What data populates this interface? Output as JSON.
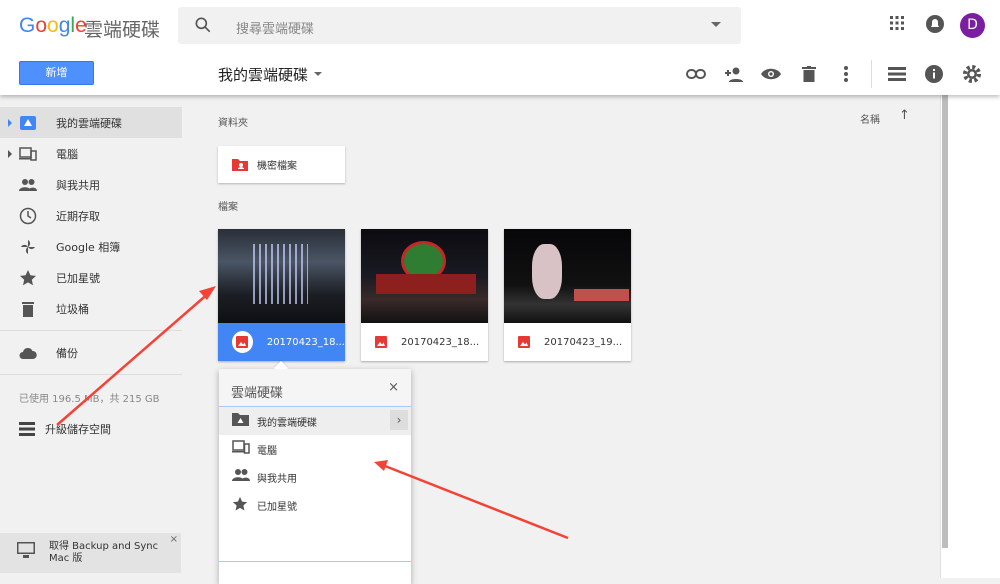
{
  "header": {
    "logo": "Google",
    "product": "雲端硬碟",
    "search_placeholder": "搜尋雲端硬碟",
    "avatar_letter": "D"
  },
  "toolbar": {
    "new_label": "新增",
    "breadcrumb": "我的雲端硬碟"
  },
  "sidebar": {
    "items": [
      {
        "label": "我的雲端硬碟"
      },
      {
        "label": "電腦"
      },
      {
        "label": "與我共用"
      },
      {
        "label": "近期存取"
      },
      {
        "label": "Google 相簿"
      },
      {
        "label": "已加星號"
      },
      {
        "label": "垃圾桶"
      },
      {
        "label": "備份"
      }
    ],
    "usage": "已使用 196.5 MB，共 215 GB",
    "upgrade": "升級儲存空間",
    "promo": "取得 Backup and Sync Mac 版",
    "promo_close": "×"
  },
  "main": {
    "folders_heading": "資料夾",
    "sort_label": "名稱",
    "folders": [
      {
        "name": "機密檔案"
      }
    ],
    "files_heading": "檔案",
    "files": [
      {
        "name": "20170423_18..."
      },
      {
        "name": "20170423_18..."
      },
      {
        "name": "20170423_19..."
      }
    ]
  },
  "popup": {
    "title": "雲端硬碟",
    "close": "×",
    "items": [
      {
        "label": "我的雲端硬碟"
      },
      {
        "label": "電腦"
      },
      {
        "label": "與我共用"
      },
      {
        "label": "已加星號"
      }
    ]
  },
  "colors": {
    "accent": "#4285f4",
    "annotation": "#f44336"
  }
}
